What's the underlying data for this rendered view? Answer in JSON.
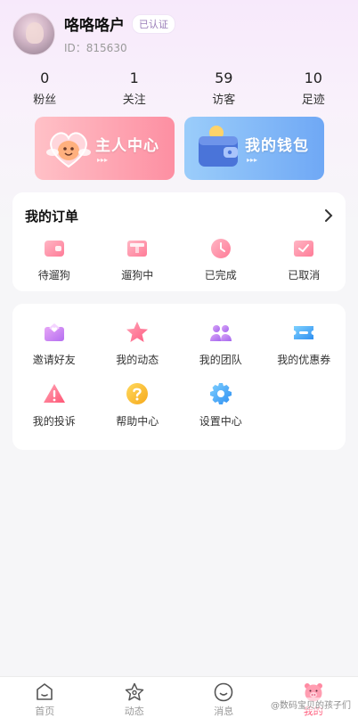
{
  "profile": {
    "username": "咯咯咯户",
    "verified_badge": "已认证",
    "uid": "ID：815630"
  },
  "stats": [
    {
      "value": "0",
      "label": "粉丝"
    },
    {
      "value": "1",
      "label": "关注"
    },
    {
      "value": "59",
      "label": "访客"
    },
    {
      "value": "10",
      "label": "足迹"
    }
  ],
  "banners": {
    "host": {
      "title": "主人中心",
      "icon": "heart-mascot-icon"
    },
    "wallet": {
      "title": "我的钱包",
      "icon": "wallet-icon"
    }
  },
  "orders": {
    "title": "我的订单",
    "items": [
      {
        "label": "待遛狗",
        "icon": "wallet-card-icon"
      },
      {
        "label": "遛狗中",
        "icon": "book-icon"
      },
      {
        "label": "已完成",
        "icon": "clock-icon"
      },
      {
        "label": "已取消",
        "icon": "check-envelope-icon"
      }
    ]
  },
  "tools": [
    {
      "label": "邀请好友",
      "icon": "invite-envelope-icon"
    },
    {
      "label": "我的动态",
      "icon": "star-icon"
    },
    {
      "label": "我的团队",
      "icon": "team-icon"
    },
    {
      "label": "我的优惠券",
      "icon": "coupon-icon"
    },
    {
      "label": "我的投诉",
      "icon": "warning-icon"
    },
    {
      "label": "帮助中心",
      "icon": "help-icon"
    },
    {
      "label": "设置中心",
      "icon": "gear-icon"
    }
  ],
  "tabbar": [
    {
      "label": "首页",
      "icon": "home-icon",
      "active": false
    },
    {
      "label": "动态",
      "icon": "star-outline-icon",
      "active": false
    },
    {
      "label": "消息",
      "icon": "smile-icon",
      "active": false
    },
    {
      "label": "我的",
      "icon": "pig-face-icon",
      "active": true
    }
  ],
  "watermark": "@数码宝贝的孩子们",
  "colors": {
    "accent": "#ff5a7a",
    "host_banner": "#fd8fa2",
    "wallet_banner": "#6fa8f5",
    "page_bg": "#f6f6f8"
  }
}
